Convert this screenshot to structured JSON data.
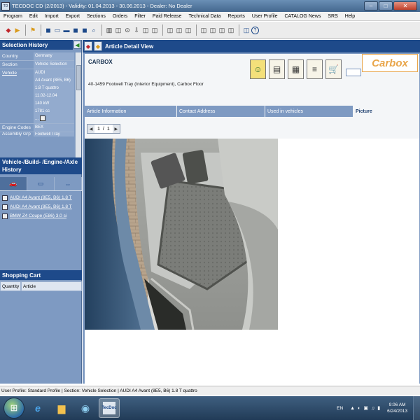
{
  "window": {
    "title": "TECDOC CD (2/2013)  -  Validity: 01.04.2013 - 30.06.2013 - Dealer: No Dealer",
    "app_icon": "TD",
    "minimize": "–",
    "maximize": "□",
    "close": "✕"
  },
  "menu": [
    "Program",
    "Edit",
    "Import",
    "Export",
    "Sections",
    "Orders",
    "Filter",
    "Paid Release",
    "Technical Data",
    "Reports",
    "User Profile",
    "CATALOG News",
    "SRS",
    "Help"
  ],
  "toolbar": {
    "icons": [
      "◆",
      "▶",
      "⚑",
      "◼",
      "▭",
      "▬",
      "◼",
      "◼",
      "⌕",
      "▥",
      "◫",
      "⊙",
      "⇩",
      "◫",
      "◫",
      "◫",
      "◫",
      "◫",
      "◫",
      "◫",
      "◫",
      "◫",
      "◫",
      "?"
    ]
  },
  "selection_history": {
    "title": "Selection History",
    "collapse_icon": "◀",
    "rows": [
      {
        "label": "Country",
        "values": [
          "Germany"
        ]
      },
      {
        "label": "Section",
        "values": [
          "Vehicle Selection"
        ]
      },
      {
        "label": "Vehicle",
        "values": [
          "AUDI",
          "A4 Avant (8E5, B6)",
          "1.8 T quattro",
          "11.02-12.04",
          "140 kW",
          "1781 cc",
          "..."
        ]
      },
      {
        "label": "Engine Codes",
        "values": [
          "BEX"
        ]
      },
      {
        "label": "Assembly Grp",
        "values": [
          "Footwell Tray"
        ]
      }
    ]
  },
  "vehicle_history": {
    "title": "Vehicle-/Build- /Engine-/Axle History",
    "tabs": [
      "🚗",
      "▭",
      "⇔"
    ],
    "items": [
      "AUDI A4 Avant (8E5, B6) 1.8 T",
      "AUDI A4 Avant (8E5, B6) 1.8 T",
      "BMW Z4 Coupe (E86) 3.0 si"
    ]
  },
  "shopping_cart": {
    "title": "Shopping Cart",
    "col_quantity": "Quantity",
    "col_article": "Article"
  },
  "article_detail": {
    "title": "Article Detail View",
    "back_icon": "◆",
    "forward_icon": "◆",
    "brand": "CARBOX",
    "description": "40-1459 Footwell Tray (Interior Equipment), Carbox Floor",
    "logo_text": "Carbox",
    "quantity_value": "",
    "action_icons": [
      "☺",
      "▤",
      "▦",
      "≡",
      "🛒"
    ],
    "tabs": [
      "Article Information",
      "Contact Address",
      "Used in vehicles",
      "Picture"
    ],
    "pager": {
      "prev": "◀",
      "current": "1",
      "separator": "/",
      "total": "1",
      "next": "▶"
    }
  },
  "status_bar": {
    "text": "User Profile: Standard Profile | Section: Vehicle Selection | AUDI A4 Avant (8E5, B6) 1.8 T quattro"
  },
  "taskbar": {
    "start_icon": "⊞",
    "apps": [
      "e",
      "▆",
      "◉",
      "TecDoc"
    ],
    "lang": "EN",
    "tray_icons": [
      "▲",
      "◐",
      "▣",
      "♫",
      "▮"
    ],
    "time": "9:06 AM",
    "date": "6/24/2013"
  }
}
